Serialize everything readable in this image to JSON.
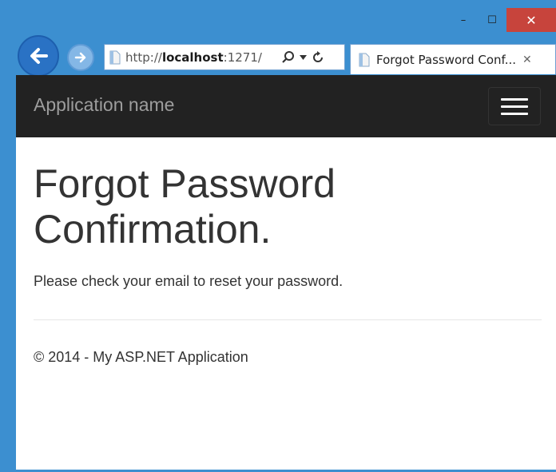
{
  "window": {
    "controls": {
      "minimize": "–",
      "maximize": "☐",
      "close": "✕"
    }
  },
  "toolbar": {
    "back_icon": "back-arrow-icon",
    "forward_icon": "forward-arrow-icon"
  },
  "address_bar": {
    "url_prefix": "http://",
    "url_host": "localhost",
    "url_rest": ":1271/",
    "search_icon": "search-icon",
    "dropdown_icon": "chevron-down-icon",
    "refresh_icon": "refresh-icon"
  },
  "tab": {
    "title": "Forgot Password Conf...",
    "close": "✕"
  },
  "navbar": {
    "brand": "Application name",
    "toggle_icon": "hamburger-menu-icon"
  },
  "main": {
    "heading": "Forgot Password Confirmation.",
    "message": "Please check your email to reset your password."
  },
  "footer": {
    "text": "© 2014 - My ASP.NET Application"
  },
  "colors": {
    "window_frame": "#3c8fd0",
    "close_button": "#c7443c",
    "navbar_bg": "#222222",
    "brand_text": "#9d9d9d"
  }
}
